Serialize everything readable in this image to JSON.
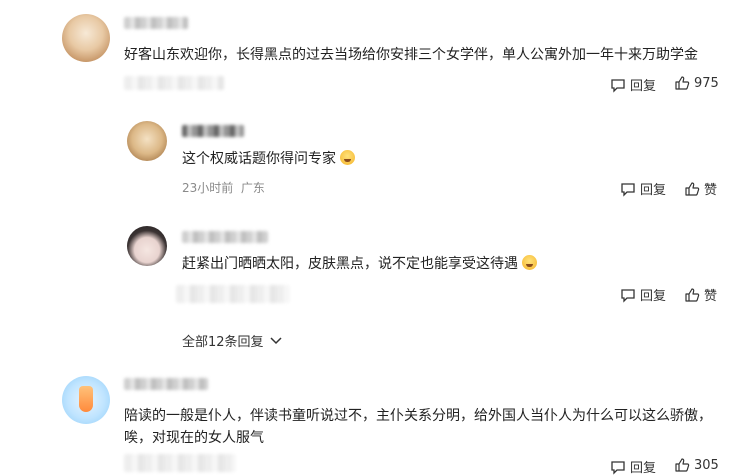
{
  "comments": [
    {
      "text": "好客山东欢迎你，长得黑点的过去当场给你安排三个女学伴，单人公寓外加一年十来万助学金",
      "reply_label": "回复",
      "like_count": "975",
      "avatar_icon": "cat-avatar-icon"
    },
    {
      "text": "陪读的一般是仆人，伴读书童听说过不，主仆关系分明，给外国人当仆人为什么可以这么骄傲，",
      "text_line2": "唉，对现在的女人服气",
      "reply_label": "回复",
      "like_count": "305",
      "avatar_icon": "drink-avatar-icon"
    }
  ],
  "replies": [
    {
      "text": "这个权威话题你得问专家",
      "time": "23小时前",
      "location": "广东",
      "reply_label": "回复",
      "like_label": "赞",
      "avatar_icon": "cat-avatar-icon"
    },
    {
      "text": "赶紧出门晒晒太阳，皮肤黑点，说不定也能享受这待遇",
      "reply_label": "回复",
      "like_label": "赞",
      "avatar_icon": "girl-avatar-icon"
    }
  ],
  "more_replies_label": "全部12条回复"
}
